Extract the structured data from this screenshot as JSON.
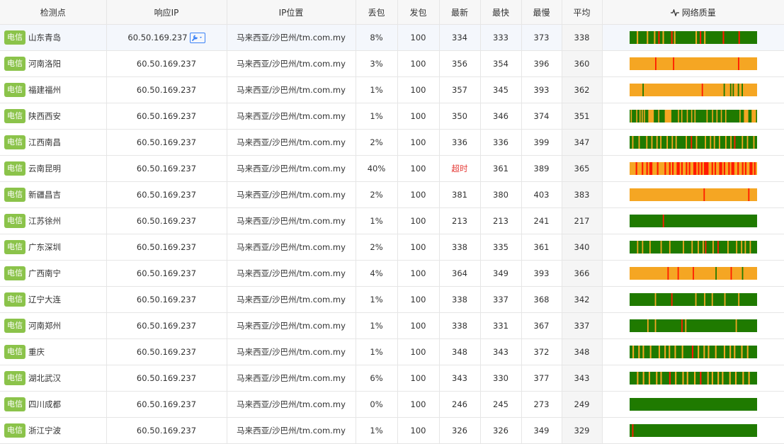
{
  "header": {
    "location": "检测点",
    "ip": "响应IP",
    "ip_location": "IP位置",
    "loss": "丢包",
    "sent": "发包",
    "latest": "最新",
    "fastest": "最快",
    "slowest": "最慢",
    "average": "平均",
    "quality": "网络质量",
    "quality_icon": "activity-icon"
  },
  "colors": {
    "good": "#1f7a00",
    "warn": "#f5a623",
    "bad": "#ff1a00",
    "isp_badge": "#8bc34a"
  },
  "rows": [
    {
      "isp": "电信",
      "city": "山东青岛",
      "ip": "60.50.169.237",
      "ip_loc": "马来西亚/沙巴州/tm.com.my",
      "loss": "8%",
      "sent": "100",
      "latest": "334",
      "fastest": "333",
      "slowest": "373",
      "avg": "338",
      "quality": "g5,o1,g6,o1,g4,o1,g2,r1,g2,o1,g5,r1,g1,o1,g14,o1,g2,r1,g2,o1,g12,r1,g10,r1,g12"
    },
    {
      "isp": "电信",
      "city": "河南洛阳",
      "ip": "60.50.169.237",
      "ip_loc": "马来西亚/沙巴州/tm.com.my",
      "loss": "3%",
      "sent": "100",
      "latest": "356",
      "fastest": "354",
      "slowest": "396",
      "avg": "360",
      "quality": "o20,r1,o13,r1,o50,r1,o14"
    },
    {
      "isp": "电信",
      "city": "福建福州",
      "ip": "60.50.169.237",
      "ip_loc": "马来西亚/沙巴州/tm.com.my",
      "loss": "1%",
      "sent": "100",
      "latest": "357",
      "fastest": "345",
      "slowest": "393",
      "avg": "362",
      "quality": "o10,g1,o45,r1,o16,g1,o4,g1,o1,g1,o3,g1,o2,g1,o11"
    },
    {
      "isp": "电信",
      "city": "陕西西安",
      "ip": "60.50.169.237",
      "ip_loc": "马来西亚/沙巴州/tm.com.my",
      "loss": "1%",
      "sent": "100",
      "latest": "350",
      "fastest": "346",
      "slowest": "374",
      "avg": "351",
      "quality": "g1,o1,g4,o1,g2,o1,g1,o1,g1,o1,g3,o5,g4,o1,g5,o6,g6,o1,g2,o1,g4,o1,g3,o1,g2,o1,g10,o1,g4,o1,g3,o1,g3,o1,g3,o1,g12,o1,g3,o4,g3,o4,g1"
    },
    {
      "isp": "电信",
      "city": "江西南昌",
      "ip": "60.50.169.237",
      "ip_loc": "马来西亚/沙巴州/tm.com.my",
      "loss": "2%",
      "sent": "100",
      "latest": "336",
      "fastest": "336",
      "slowest": "399",
      "avg": "347",
      "quality": "g2,o1,g4,o1,g5,o1,g3,o1,g3,o1,g2,o1,g4,o1,g3,o1,g2,o1,g7,o1,g3,r1,g3,o1,g6,o1,g3,o1,g2,o1,g3,o1,g4,o1,g3,o1,g2,r1,g5,o1,g3,o1,g4,o1,g2"
    },
    {
      "isp": "电信",
      "city": "云南昆明",
      "ip": "60.50.169.237",
      "ip_loc": "马来西亚/沙巴州/tm.com.my",
      "loss": "40%",
      "sent": "100",
      "latest": "超时",
      "latest_timeout": true,
      "fastest": "361",
      "slowest": "389",
      "avg": "365",
      "quality": "o4,r1,o3,r1,o2,r1,o1,r2,o3,r1,o4,r1,o2,r1,o1,r1,o2,r2,o1,r1,o2,r1,o1,r1,o2,r2,o1,r1,o1,r1,o1,r3,o2,r1,o1,r1,o2,r2,o1,r1,o2,r1,o1,r2,o2,r1,o2,r1,o1,r1,o2,r2,o1,r1,o1"
    },
    {
      "isp": "电信",
      "city": "新疆昌吉",
      "ip": "60.50.169.237",
      "ip_loc": "马来西亚/沙巴州/tm.com.my",
      "loss": "2%",
      "sent": "100",
      "latest": "381",
      "fastest": "380",
      "slowest": "403",
      "avg": "383",
      "quality": "o58,r1,o34,r1,o6"
    },
    {
      "isp": "电信",
      "city": "江苏徐州",
      "ip": "60.50.169.237",
      "ip_loc": "马来西亚/沙巴州/tm.com.my",
      "loss": "1%",
      "sent": "100",
      "latest": "213",
      "fastest": "213",
      "slowest": "241",
      "avg": "217",
      "quality": "g26,r1,g73"
    },
    {
      "isp": "电信",
      "city": "广东深圳",
      "ip": "60.50.169.237",
      "ip_loc": "马来西亚/沙巴州/tm.com.my",
      "loss": "2%",
      "sent": "100",
      "latest": "338",
      "fastest": "335",
      "slowest": "361",
      "avg": "340",
      "quality": "g6,o1,g3,o1,g5,o1,g8,o1,g6,o1,g10,o1,g6,o1,g4,o1,g3,o1,g1,r1,g5,o1,g3,r1,g7,o1,g6,o1,g3,o1,g2,o1,g3,o1,g5"
    },
    {
      "isp": "电信",
      "city": "广西南宁",
      "ip": "60.50.169.237",
      "ip_loc": "马来西亚/沙巴州/tm.com.my",
      "loss": "4%",
      "sent": "100",
      "latest": "364",
      "fastest": "349",
      "slowest": "393",
      "avg": "366",
      "quality": "o30,r1,o7,r1,o11,r1,o17,g1,o11,r1,o8,g1,o11"
    },
    {
      "isp": "电信",
      "city": "辽宁大连",
      "ip": "60.50.169.237",
      "ip_loc": "马来西亚/沙巴州/tm.com.my",
      "loss": "1%",
      "sent": "100",
      "latest": "338",
      "fastest": "337",
      "slowest": "368",
      "avg": "342",
      "quality": "g20,o1,g12,r1,g18,o1,g6,o1,g5,o1,g9,o1,g10,o1,g14"
    },
    {
      "isp": "电信",
      "city": "河南郑州",
      "ip": "60.50.169.237",
      "ip_loc": "马来西亚/沙巴州/tm.com.my",
      "loss": "1%",
      "sent": "100",
      "latest": "338",
      "fastest": "331",
      "slowest": "367",
      "avg": "337",
      "quality": "g14,o1,g5,o1,g20,r1,g2,o1,g39,o1,g16"
    },
    {
      "isp": "电信",
      "city": "重庆",
      "ip": "60.50.169.237",
      "ip_loc": "马来西亚/沙巴州/tm.com.my",
      "loss": "1%",
      "sent": "100",
      "latest": "348",
      "fastest": "343",
      "slowest": "372",
      "avg": "348",
      "quality": "g2,o1,g3,o1,g2,o1,g4,o1,g5,o1,g3,o1,g2,o1,g3,o1,g4,o1,g6,r1,g3,o1,g3,o1,g2,o1,g4,o1,g5,o1,g3,o1,g2,o1,g4,o1,g3,o1,g6"
    },
    {
      "isp": "电信",
      "city": "湖北武汉",
      "ip": "60.50.169.237",
      "ip_loc": "马来西亚/沙巴州/tm.com.my",
      "loss": "6%",
      "sent": "100",
      "latest": "343",
      "fastest": "330",
      "slowest": "377",
      "avg": "343",
      "quality": "g5,o1,g3,o1,g3,o1,g4,o1,g2,o1,g5,r1,g3,o1,g4,o1,g2,o1,g4,o1,g3,r1,g4,o1,g2,o1,g3,o1,g2,o1,g4,o1,g3,o1,g4,o1,g3,o1,g5"
    },
    {
      "isp": "电信",
      "city": "四川成都",
      "ip": "60.50.169.237",
      "ip_loc": "马来西亚/沙巴州/tm.com.my",
      "loss": "0%",
      "sent": "100",
      "latest": "246",
      "fastest": "245",
      "slowest": "273",
      "avg": "249",
      "quality": "g100"
    },
    {
      "isp": "电信",
      "city": "浙江宁波",
      "ip": "60.50.169.237",
      "ip_loc": "马来西亚/沙巴州/tm.com.my",
      "loss": "1%",
      "sent": "100",
      "latest": "326",
      "fastest": "326",
      "slowest": "349",
      "avg": "329",
      "quality": "g2,r1,g97"
    }
  ]
}
